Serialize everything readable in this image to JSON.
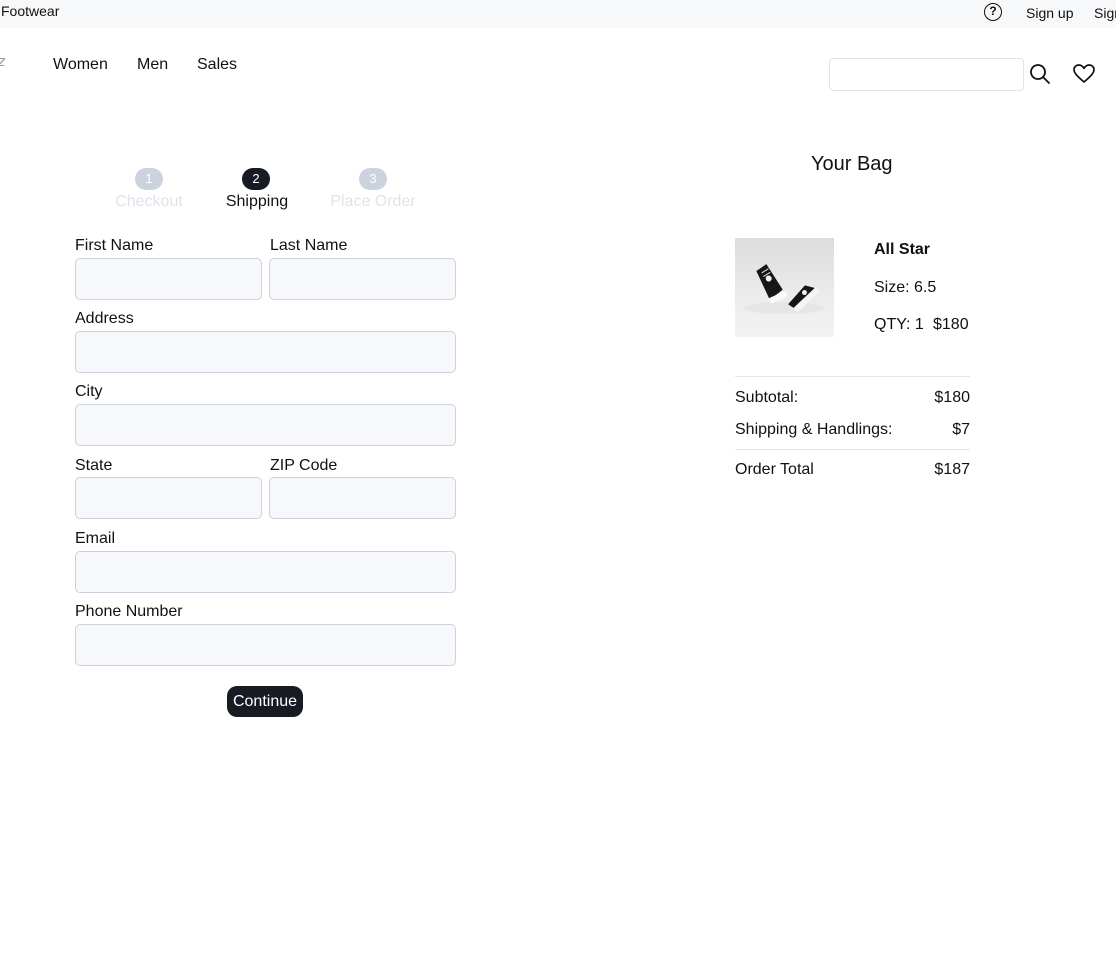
{
  "topbar": {
    "brand": "Footwear",
    "help_icon": "help-circle-icon",
    "sign_up": "Sign up",
    "sign_in": "Sign in"
  },
  "nav": {
    "logo_icon": "brand-logo-icon",
    "items": [
      "Women",
      "Men",
      "Sales"
    ],
    "search_icon": "search-icon",
    "wishlist_icon": "heart-icon"
  },
  "steps": [
    {
      "number": "1",
      "label": "Checkout",
      "state": "inactive"
    },
    {
      "number": "2",
      "label": "Shipping",
      "state": "active"
    },
    {
      "number": "3",
      "label": "Place Order",
      "state": "inactive"
    }
  ],
  "form": {
    "first_name_label": "First Name",
    "last_name_label": "Last Name",
    "address_label": "Address",
    "city_label": "City",
    "state_label": "State",
    "zip_label": "ZIP Code",
    "email_label": "Email",
    "phone_label": "Phone Number",
    "continue_label": "Continue"
  },
  "bag": {
    "title": "Your Bag",
    "item": {
      "name": "All Star",
      "size": "Size: 6.5",
      "qty": "QTY: 1",
      "price": "$180",
      "image_icon": "sneaker-product-image"
    },
    "subtotal_label": "Subtotal:",
    "subtotal_value": "$180",
    "shipping_label": "Shipping & Handlings:",
    "shipping_value": "$7",
    "total_label": "Order Total",
    "total_value": "$187"
  },
  "colors": {
    "accent": "#171b24",
    "topbar_bg": "#f7f8fa",
    "input_bg": "#f7f8fb",
    "step_inactive": "#ccd3de"
  }
}
